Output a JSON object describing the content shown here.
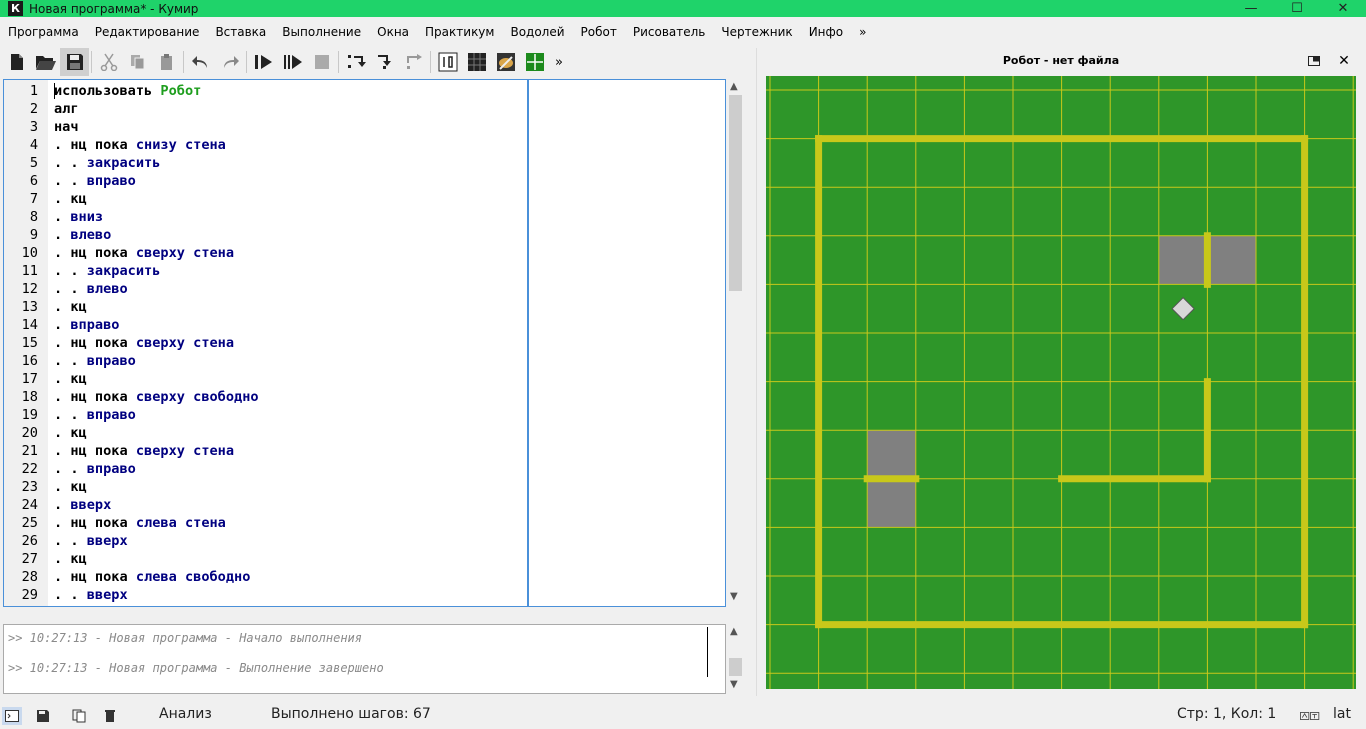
{
  "window": {
    "title": "Новая программа* - Кумир",
    "logo_letter": "К",
    "minimize": "—",
    "maximize": "☐",
    "close": "✕"
  },
  "menu": [
    "Программа",
    "Редактирование",
    "Вставка",
    "Выполнение",
    "Окна",
    "Практикум",
    "Водолей",
    "Робот",
    "Рисователь",
    "Чертежник",
    "Инфо",
    "»"
  ],
  "toolbar": {
    "overflow": "»",
    "icons": [
      "new-file-icon",
      "open-file-icon",
      "save-icon",
      "cut-icon",
      "copy-icon",
      "paste-icon",
      "undo-icon",
      "redo-icon",
      "run-icon",
      "run-step-icon",
      "stop-icon",
      "step-over-icon",
      "step-into-icon",
      "step-out-icon",
      "counter-icon",
      "grid-icon",
      "painter-icon",
      "drawer-icon"
    ]
  },
  "editor": {
    "lines": [
      [
        {
          "t": "использовать ",
          "c": "kw"
        },
        {
          "t": "Робот",
          "c": "gr"
        }
      ],
      [
        {
          "t": "алг",
          "c": "kw"
        }
      ],
      [
        {
          "t": "нач",
          "c": "kw"
        }
      ],
      [
        {
          "t": ". нц пока ",
          "c": "kw"
        },
        {
          "t": "снизу стена",
          "c": "cm"
        }
      ],
      [
        {
          "t": ". . ",
          "c": "kw"
        },
        {
          "t": "закрасить",
          "c": "cm"
        }
      ],
      [
        {
          "t": ". . ",
          "c": "kw"
        },
        {
          "t": "вправо",
          "c": "cm"
        }
      ],
      [
        {
          "t": ". кц",
          "c": "kw"
        }
      ],
      [
        {
          "t": ". ",
          "c": "kw"
        },
        {
          "t": "вниз",
          "c": "cm"
        }
      ],
      [
        {
          "t": ". ",
          "c": "kw"
        },
        {
          "t": "влево",
          "c": "cm"
        }
      ],
      [
        {
          "t": ". нц пока ",
          "c": "kw"
        },
        {
          "t": "сверху стена",
          "c": "cm"
        }
      ],
      [
        {
          "t": ". . ",
          "c": "kw"
        },
        {
          "t": "закрасить",
          "c": "cm"
        }
      ],
      [
        {
          "t": ". . ",
          "c": "kw"
        },
        {
          "t": "влево",
          "c": "cm"
        }
      ],
      [
        {
          "t": ". кц",
          "c": "kw"
        }
      ],
      [
        {
          "t": ". ",
          "c": "kw"
        },
        {
          "t": "вправо",
          "c": "cm"
        }
      ],
      [
        {
          "t": ". нц пока ",
          "c": "kw"
        },
        {
          "t": "сверху стена",
          "c": "cm"
        }
      ],
      [
        {
          "t": ". . ",
          "c": "kw"
        },
        {
          "t": "вправо",
          "c": "cm"
        }
      ],
      [
        {
          "t": ". кц",
          "c": "kw"
        }
      ],
      [
        {
          "t": ". нц пока ",
          "c": "kw"
        },
        {
          "t": "сверху свободно",
          "c": "cm"
        }
      ],
      [
        {
          "t": ". . ",
          "c": "kw"
        },
        {
          "t": "вправо",
          "c": "cm"
        }
      ],
      [
        {
          "t": ". кц",
          "c": "kw"
        }
      ],
      [
        {
          "t": ". нц пока ",
          "c": "kw"
        },
        {
          "t": "сверху стена",
          "c": "cm"
        }
      ],
      [
        {
          "t": ". . ",
          "c": "kw"
        },
        {
          "t": "вправо",
          "c": "cm"
        }
      ],
      [
        {
          "t": ". кц",
          "c": "kw"
        }
      ],
      [
        {
          "t": ". ",
          "c": "kw"
        },
        {
          "t": "вверх",
          "c": "cm"
        }
      ],
      [
        {
          "t": ". нц пока ",
          "c": "kw"
        },
        {
          "t": "слева стена",
          "c": "cm"
        }
      ],
      [
        {
          "t": ". . ",
          "c": "kw"
        },
        {
          "t": "вверх",
          "c": "cm"
        }
      ],
      [
        {
          "t": ". кц",
          "c": "kw"
        }
      ],
      [
        {
          "t": ". нц пока ",
          "c": "kw"
        },
        {
          "t": "слева свободно",
          "c": "cm"
        }
      ],
      [
        {
          "t": ". . ",
          "c": "kw"
        },
        {
          "t": "вверх",
          "c": "cm"
        }
      ]
    ]
  },
  "console": {
    "lines": [
      ">> 10:27:13 - Новая программа - Начало выполнения",
      ">> 10:27:13 - Новая программа - Выполнение завершено"
    ]
  },
  "robot": {
    "title": "Робот - нет файла",
    "colors": {
      "field": "#2e9629",
      "grid": "#c8c81a",
      "wall": "#c8c81a",
      "painted": "#808080",
      "robot": "#d8d8d8"
    },
    "grid_cols": 12,
    "grid_rows": 12,
    "painted_cells": [
      [
        8,
        3
      ],
      [
        9,
        3
      ],
      [
        2,
        7
      ],
      [
        2,
        8
      ]
    ],
    "walls": [
      {
        "from": [
          1,
          1
        ],
        "to": [
          11,
          1
        ]
      },
      {
        "from": [
          1,
          1
        ],
        "to": [
          1,
          11
        ]
      },
      {
        "from": [
          1,
          11
        ],
        "to": [
          11,
          11
        ]
      },
      {
        "from": [
          11,
          1
        ],
        "to": [
          11,
          11
        ]
      },
      {
        "from": [
          9,
          3
        ],
        "to": [
          9,
          4
        ]
      },
      {
        "from": [
          9,
          6
        ],
        "to": [
          9,
          8
        ]
      },
      {
        "from": [
          6,
          8
        ],
        "to": [
          9,
          8
        ]
      },
      {
        "from": [
          2,
          8
        ],
        "to": [
          3,
          8
        ]
      }
    ],
    "robot_position": [
      8,
      4
    ]
  },
  "status": {
    "analysis": "Анализ",
    "steps": "Выполнено шагов: 67",
    "position": "Стр: 1, Кол: 1",
    "lang": "lat"
  }
}
